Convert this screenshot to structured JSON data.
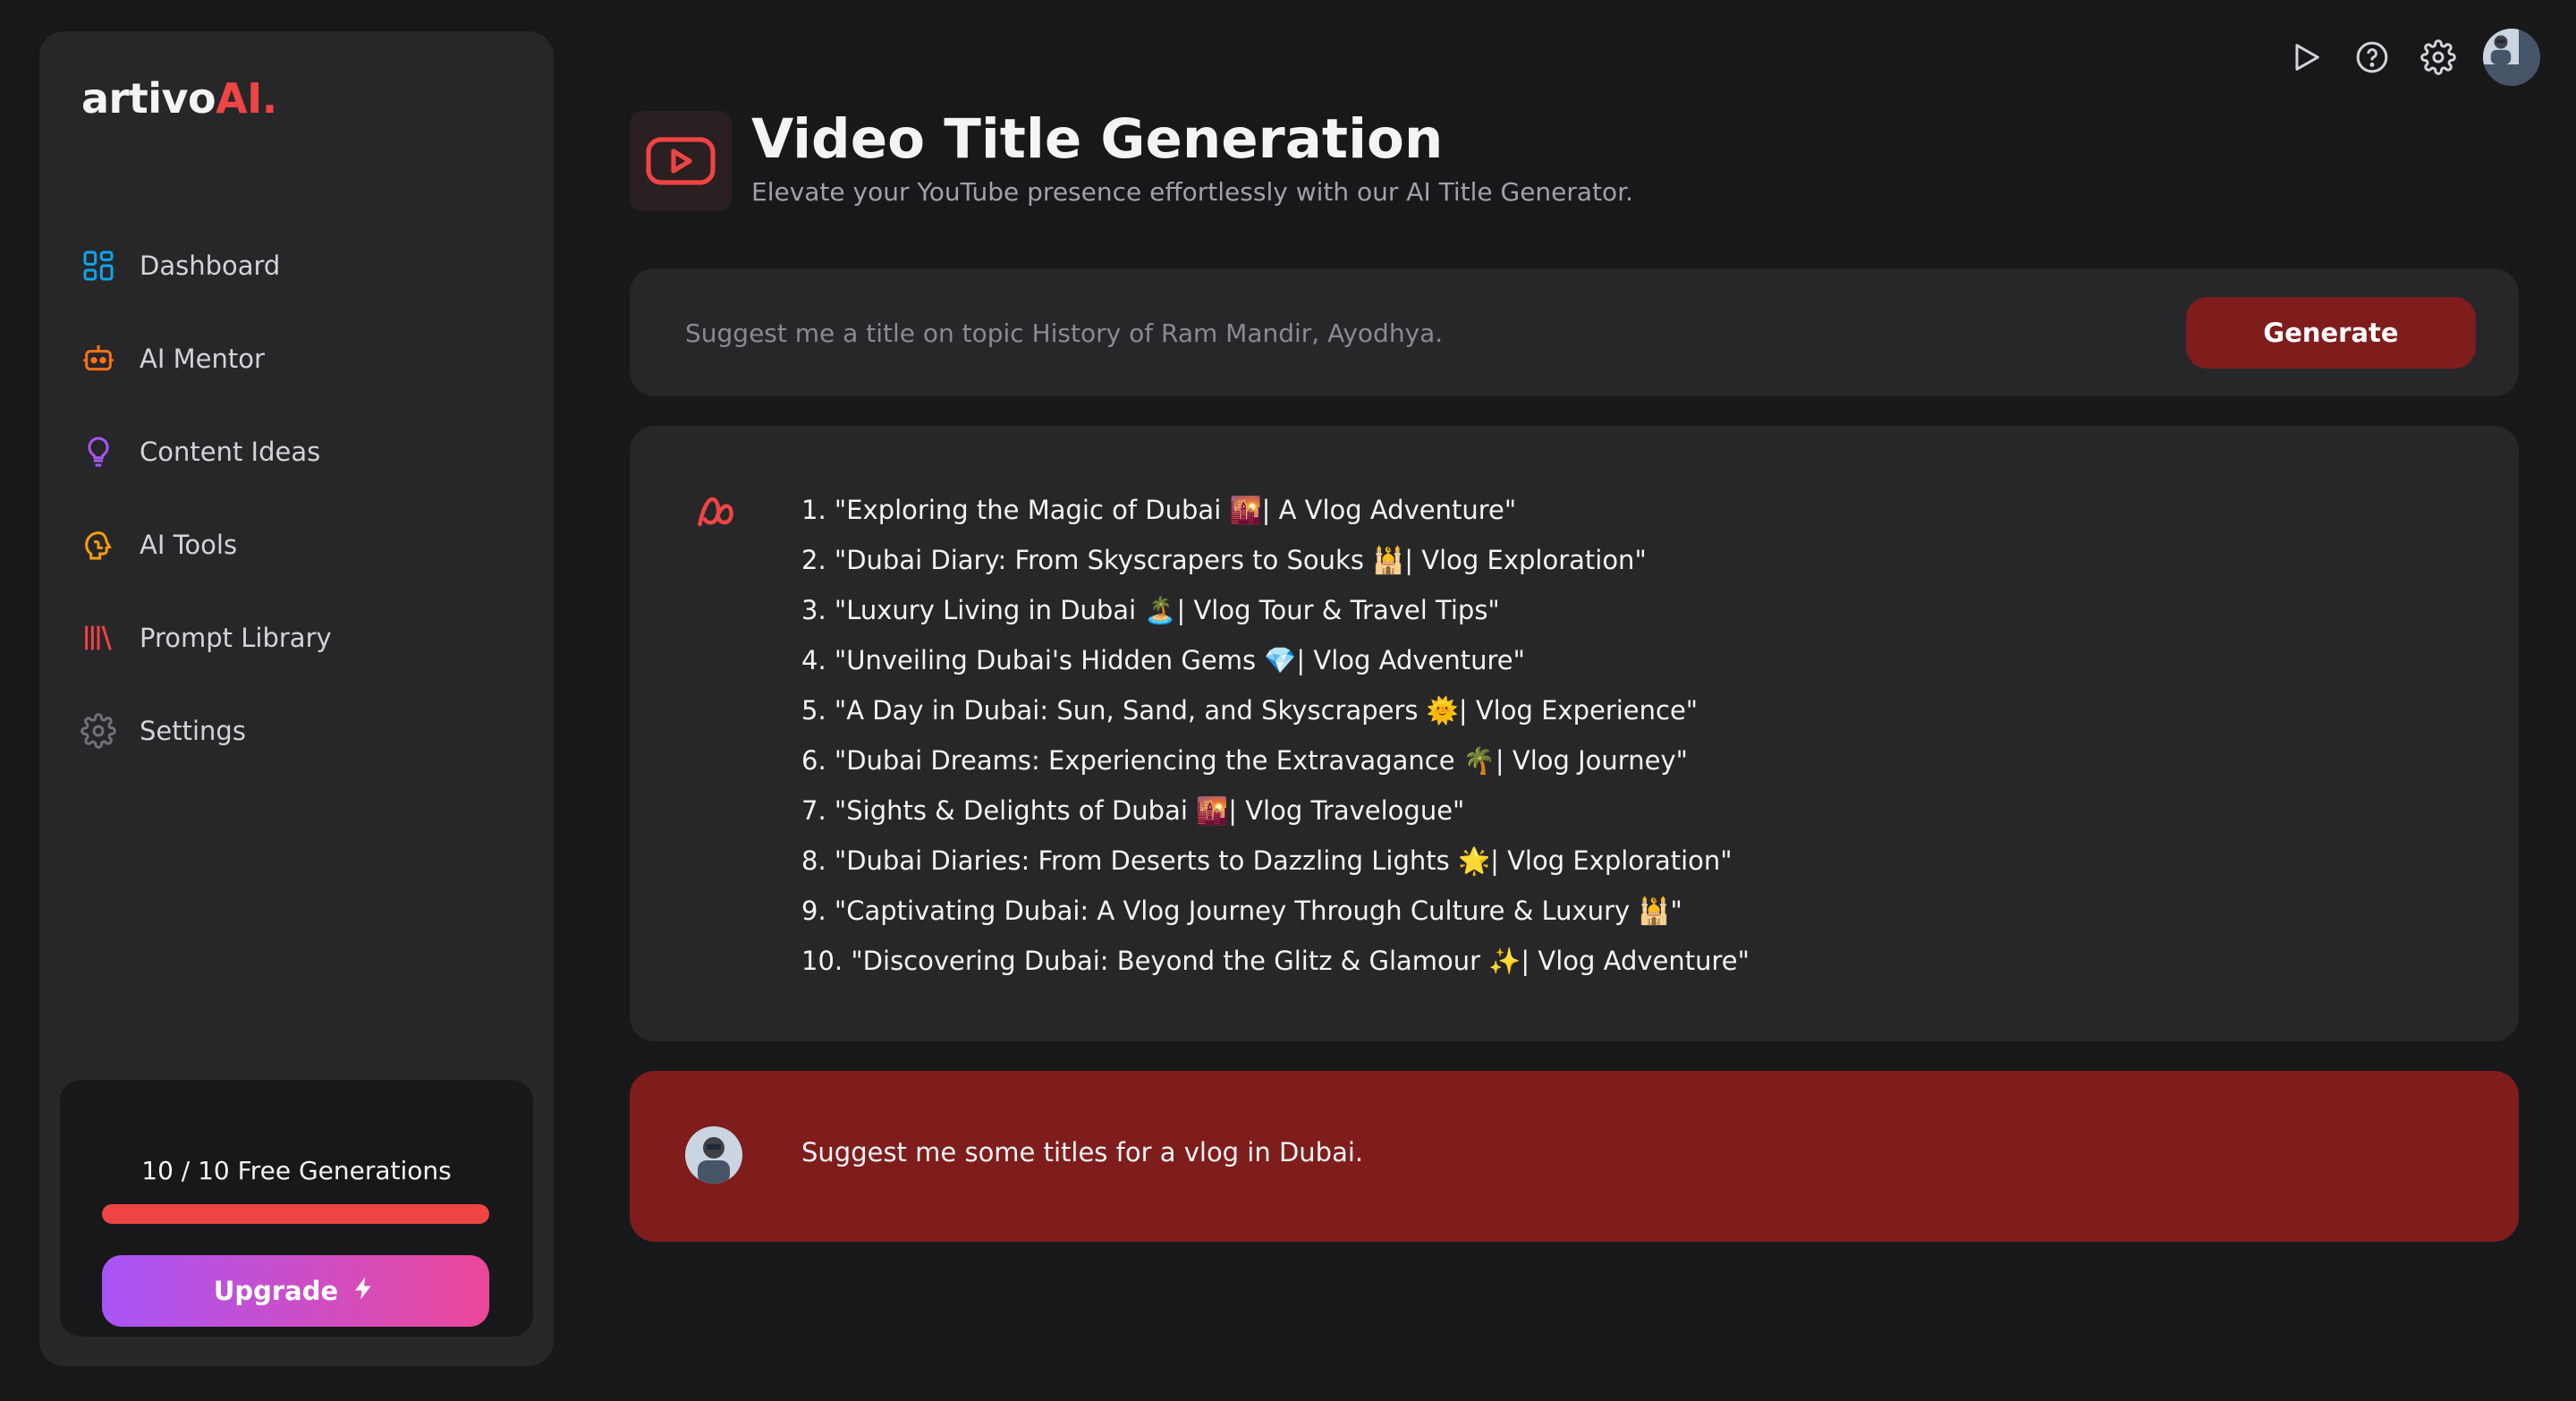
{
  "brand": {
    "name": "artivo",
    "accent": "AI.",
    "accent_color": "#ef4444"
  },
  "sidebar": {
    "items": [
      {
        "label": "Dashboard",
        "icon": "grid-icon",
        "color": "#0ea5e9"
      },
      {
        "label": "AI Mentor",
        "icon": "robot-icon",
        "color": "#f97316"
      },
      {
        "label": "Content Ideas",
        "icon": "lightbulb-icon",
        "color": "#a855f7"
      },
      {
        "label": "AI Tools",
        "icon": "brain-icon",
        "color": "#f59e0b"
      },
      {
        "label": "Prompt Library",
        "icon": "library-icon",
        "color": "#ef4444"
      },
      {
        "label": "Settings",
        "icon": "gear-icon",
        "color": "#71717a"
      }
    ]
  },
  "usage": {
    "label": "10 / 10 Free Generations",
    "progress": 1.0
  },
  "upgrade": {
    "label": "Upgrade"
  },
  "header": {
    "title": "Video Title Generation",
    "subtitle": "Elevate your YouTube presence effortlessly with our AI Title Generator."
  },
  "prompt": {
    "placeholder": "Suggest me a title on topic History of Ram Mandir, Ayodhya.",
    "button": "Generate"
  },
  "response": {
    "titles": [
      "1. \"Exploring the Magic of Dubai 🌇| A Vlog Adventure\"",
      "2. \"Dubai Diary: From Skyscrapers to Souks 🕌| Vlog Exploration\"",
      "3. \"Luxury Living in Dubai 🏝️| Vlog Tour & Travel Tips\"",
      "4. \"Unveiling Dubai's Hidden Gems 💎| Vlog Adventure\"",
      "5. \"A Day in Dubai: Sun, Sand, and Skyscrapers 🌞| Vlog Experience\"",
      "6. \"Dubai Dreams: Experiencing the Extravagance 🌴| Vlog Journey\"",
      "7. \"Sights & Delights of Dubai 🌇| Vlog Travelogue\"",
      "8. \"Dubai Diaries: From Deserts to Dazzling Lights 🌟| Vlog Exploration\"",
      "9. \"Captivating Dubai: A Vlog Journey Through Culture & Luxury 🕌\"",
      "10. \"Discovering Dubai: Beyond the Glitz & Glamour ✨| Vlog Adventure\""
    ]
  },
  "user_message": {
    "text": "Suggest me some titles for a vlog in Dubai."
  },
  "topbar": {
    "icons": [
      "play-icon",
      "help-icon",
      "gear-icon",
      "avatar"
    ]
  }
}
